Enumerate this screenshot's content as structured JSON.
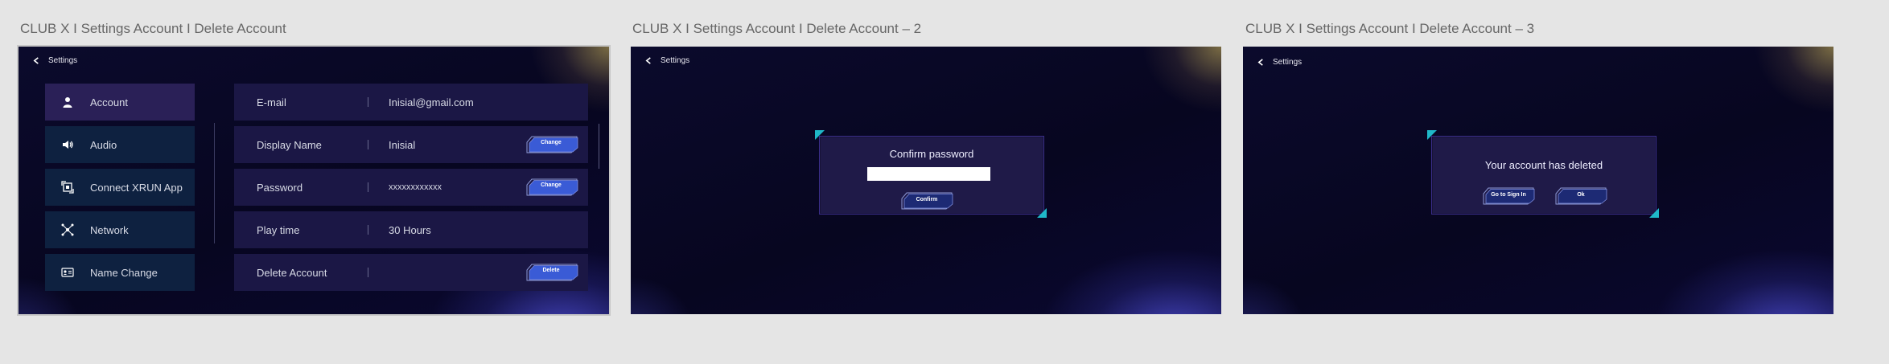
{
  "frames": [
    {
      "title": "CLUB X I Settings Account I Delete Account"
    },
    {
      "title": "CLUB X I Settings Account I Delete Account – 2"
    },
    {
      "title": "CLUB X I Settings Account I Delete Account – 3"
    }
  ],
  "back_label": "Settings",
  "nav": [
    {
      "label": "Account",
      "icon": "user-icon"
    },
    {
      "label": "Audio",
      "icon": "speaker-icon"
    },
    {
      "label": "Connect XRUN App",
      "icon": "connect-app-icon"
    },
    {
      "label": "Network",
      "icon": "network-icon"
    },
    {
      "label": "Name Change",
      "icon": "id-card-icon"
    }
  ],
  "account_rows": [
    {
      "label": "E-mail",
      "value": "Inisial@gmail.com",
      "button": ""
    },
    {
      "label": "Display Name",
      "value": "Inisial",
      "button": "Change"
    },
    {
      "label": "Password",
      "value": "xxxxxxxxxxxx",
      "button": "Change"
    },
    {
      "label": "Play time",
      "value": "30 Hours",
      "button": ""
    },
    {
      "label": "Delete Account",
      "value": "",
      "button": "Delete"
    }
  ],
  "confirm_dialog": {
    "title": "Confirm password",
    "input_value": "",
    "confirm_label": "Confirm"
  },
  "deleted_dialog": {
    "title": "Your account has deleted",
    "sign_in_label": "Go to Sign In",
    "ok_label": "Ok"
  },
  "colors": {
    "accent": "#3a5bd6",
    "corner": "#1fb8c8",
    "nav_bg": "#0e2140",
    "nav_active": "#2a2057",
    "row_bg": "#1b1745"
  }
}
